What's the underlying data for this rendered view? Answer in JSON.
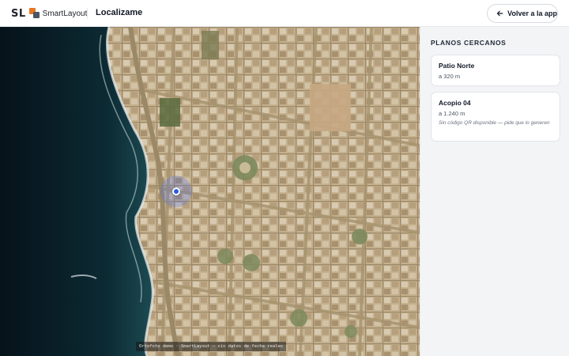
{
  "header": {
    "logo_initials": "SL",
    "logo_name": "SmartLayout",
    "title": "Localizame",
    "back_button_label": "Volver a la app",
    "back_icon": "arrow-left-icon"
  },
  "map": {
    "attribution": "Ortofoto demo · SmartLayout — sin datos de fecha reales",
    "marker_icon": "current-location-dot"
  },
  "panel": {
    "heading": "PLANOS CERCANOS",
    "items": [
      {
        "name": "Patio Norte",
        "distance": "a 320 m",
        "note": ""
      },
      {
        "name": "Acopio 04",
        "distance": "a 1.240 m",
        "note": "Sin código QR disponible — pide que lo generen"
      }
    ]
  },
  "colors": {
    "logo_accent": "#e87722",
    "location_marker": "#2b5be0",
    "panel_background": "#f3f4f6"
  }
}
